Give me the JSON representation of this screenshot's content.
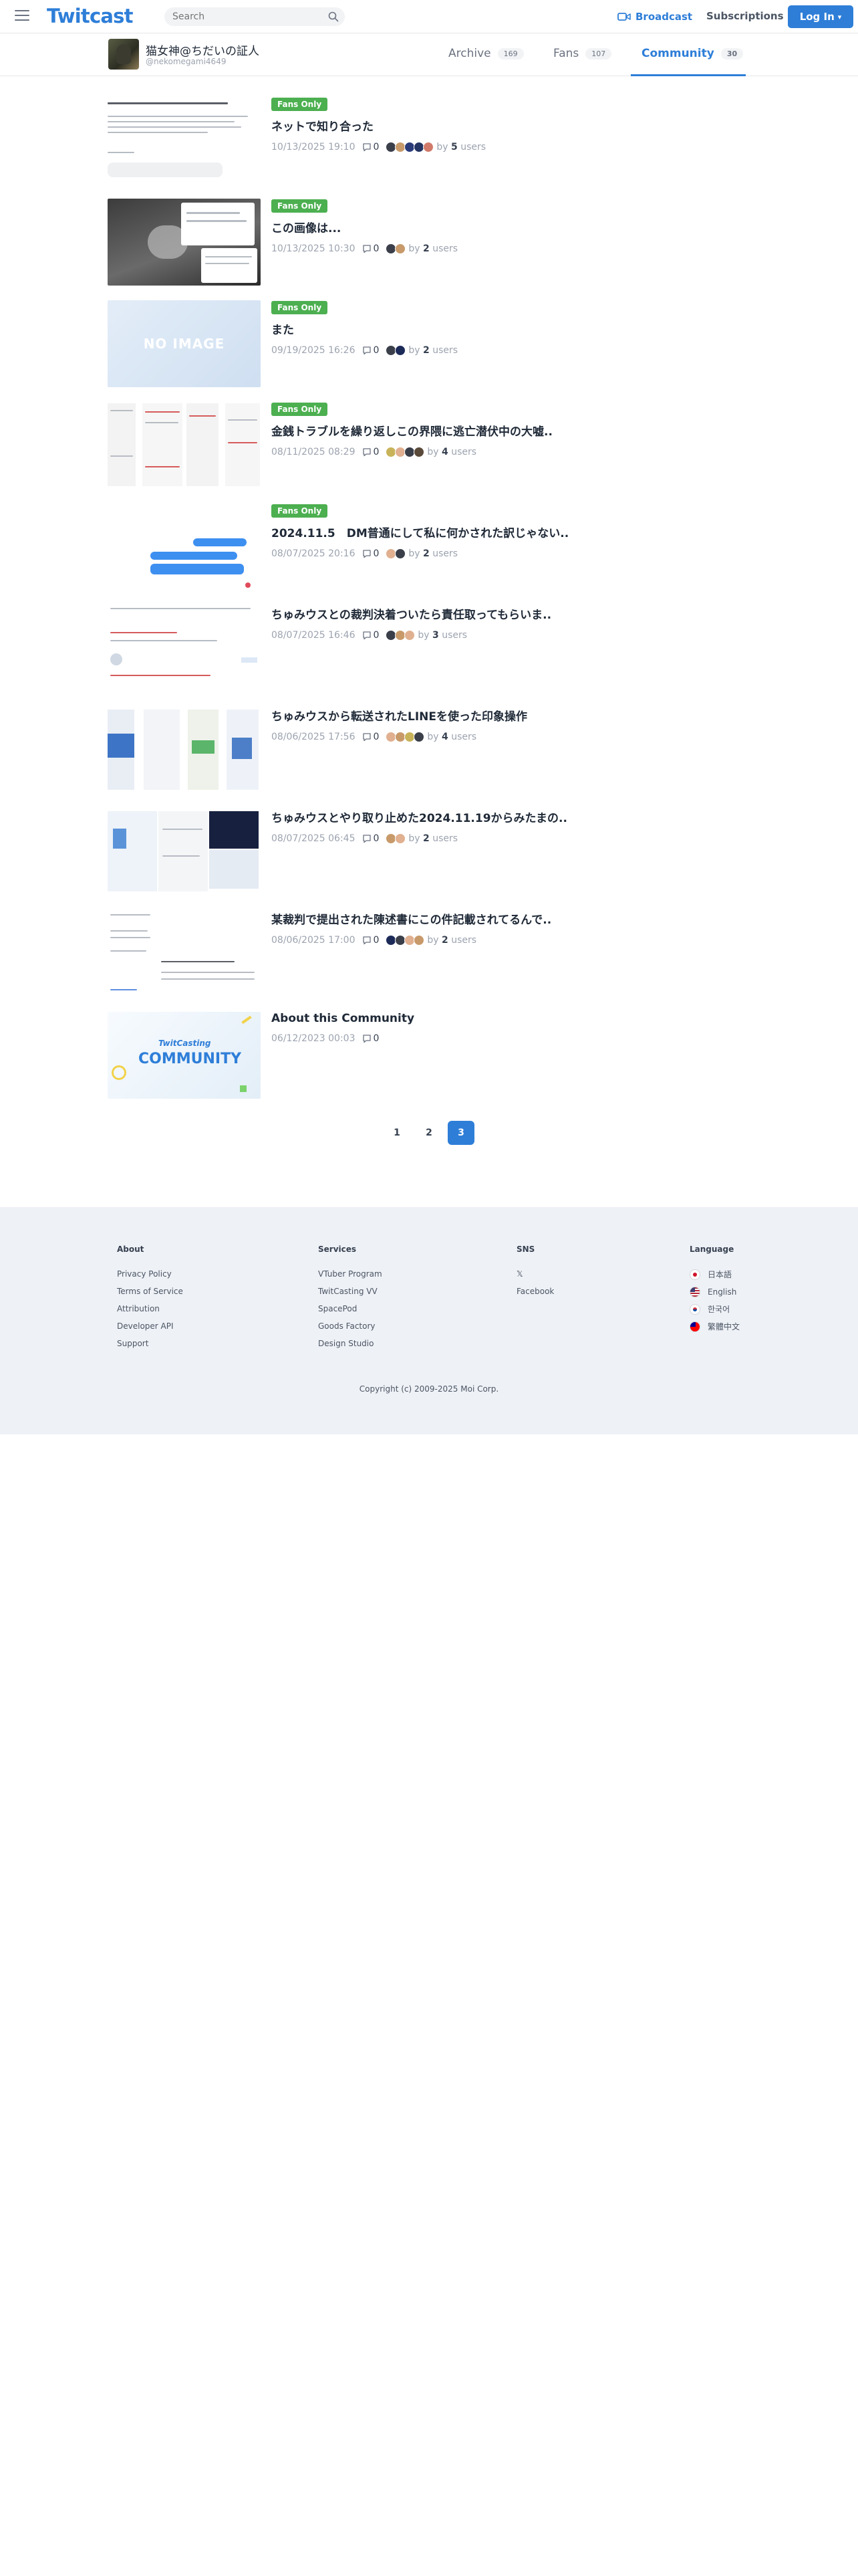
{
  "header": {
    "logo": "Twitcast",
    "search_placeholder": "Search",
    "broadcast_label": "Broadcast",
    "subscriptions_label": "Subscriptions",
    "login_label": "Log In"
  },
  "profile": {
    "name": "猫女神@ちだいの証人",
    "handle": "@nekomegami4649"
  },
  "tabs": [
    {
      "label": "Archive",
      "count": "169"
    },
    {
      "label": "Fans",
      "count": "107"
    },
    {
      "label": "Community",
      "count": "30"
    }
  ],
  "posts": [
    {
      "fans_only": "Fans Only",
      "title": "ネットで知り合った",
      "date": "10/13/2025 19:10",
      "comments": "0",
      "by_prefix": "by",
      "users": "5",
      "by_suffix": "users"
    },
    {
      "fans_only": "Fans Only",
      "title": "この画像は...",
      "date": "10/13/2025 10:30",
      "comments": "0",
      "by_prefix": "by",
      "users": "2",
      "by_suffix": "users"
    },
    {
      "fans_only": "Fans Only",
      "title": "また",
      "date": "09/19/2025 16:26",
      "comments": "0",
      "by_prefix": "by",
      "users": "2",
      "by_suffix": "users"
    },
    {
      "fans_only": "Fans Only",
      "title": "金銭トラブルを繰り返しこの界隈に逃亡潜伏中の大嘘..",
      "date": "08/11/2025 08:29",
      "comments": "0",
      "by_prefix": "by",
      "users": "4",
      "by_suffix": "users"
    },
    {
      "fans_only": "Fans Only",
      "title": "2024.11.5　DM普通にして私に何かされた訳じゃない..",
      "date": "08/07/2025 20:16",
      "comments": "0",
      "by_prefix": "by",
      "users": "2",
      "by_suffix": "users"
    },
    {
      "fans_only": "",
      "title": "ちゅみウスとの裁判決着ついたら責任取ってもらいま..",
      "date": "08/07/2025 16:46",
      "comments": "0",
      "by_prefix": "by",
      "users": "3",
      "by_suffix": "users"
    },
    {
      "fans_only": "",
      "title": "ちゅみウスから転送されたLINEを使った印象操作",
      "date": "08/06/2025 17:56",
      "comments": "0",
      "by_prefix": "by",
      "users": "4",
      "by_suffix": "users"
    },
    {
      "fans_only": "",
      "title": "ちゅみウスとやり取り止めた2024.11.19からみたまの..",
      "date": "08/07/2025 06:45",
      "comments": "0",
      "by_prefix": "by",
      "users": "2",
      "by_suffix": "users"
    },
    {
      "fans_only": "",
      "title": "某裁判で提出された陳述書にこの件記載されてるんで..",
      "date": "08/06/2025 17:00",
      "comments": "0",
      "by_prefix": "by",
      "users": "2",
      "by_suffix": "users"
    },
    {
      "fans_only": "",
      "title": "About this Community",
      "date": "06/12/2023 00:03",
      "comments": "0",
      "by_prefix": "",
      "users": "",
      "by_suffix": ""
    }
  ],
  "thumbs": {
    "no_image": "NO IMAGE",
    "tc_brand": "TwitCasting",
    "tc_community": "COMMUNITY"
  },
  "pagination": [
    "1",
    "2",
    "3"
  ],
  "pagination_active": "3",
  "footer": {
    "about": {
      "title": "About",
      "links": [
        "Privacy Policy",
        "Terms of Service",
        "Attribution",
        "Developer API",
        "Support"
      ]
    },
    "services": {
      "title": "Services",
      "links": [
        "VTuber Program",
        "TwitCasting VV",
        "SpacePod",
        "Goods Factory",
        "Design Studio"
      ]
    },
    "sns": {
      "title": "SNS",
      "links": [
        "𝕏",
        "Facebook"
      ]
    },
    "language": {
      "title": "Language",
      "links": [
        "日本語",
        "English",
        "한국어",
        "繁體中文"
      ]
    },
    "copyright": "Copyright (c) 2009-2025 Moi Corp."
  },
  "colors": {
    "accent": "#2e7ed8",
    "fans_badge": "#4caf50",
    "footer_bg": "#eef1f6"
  }
}
